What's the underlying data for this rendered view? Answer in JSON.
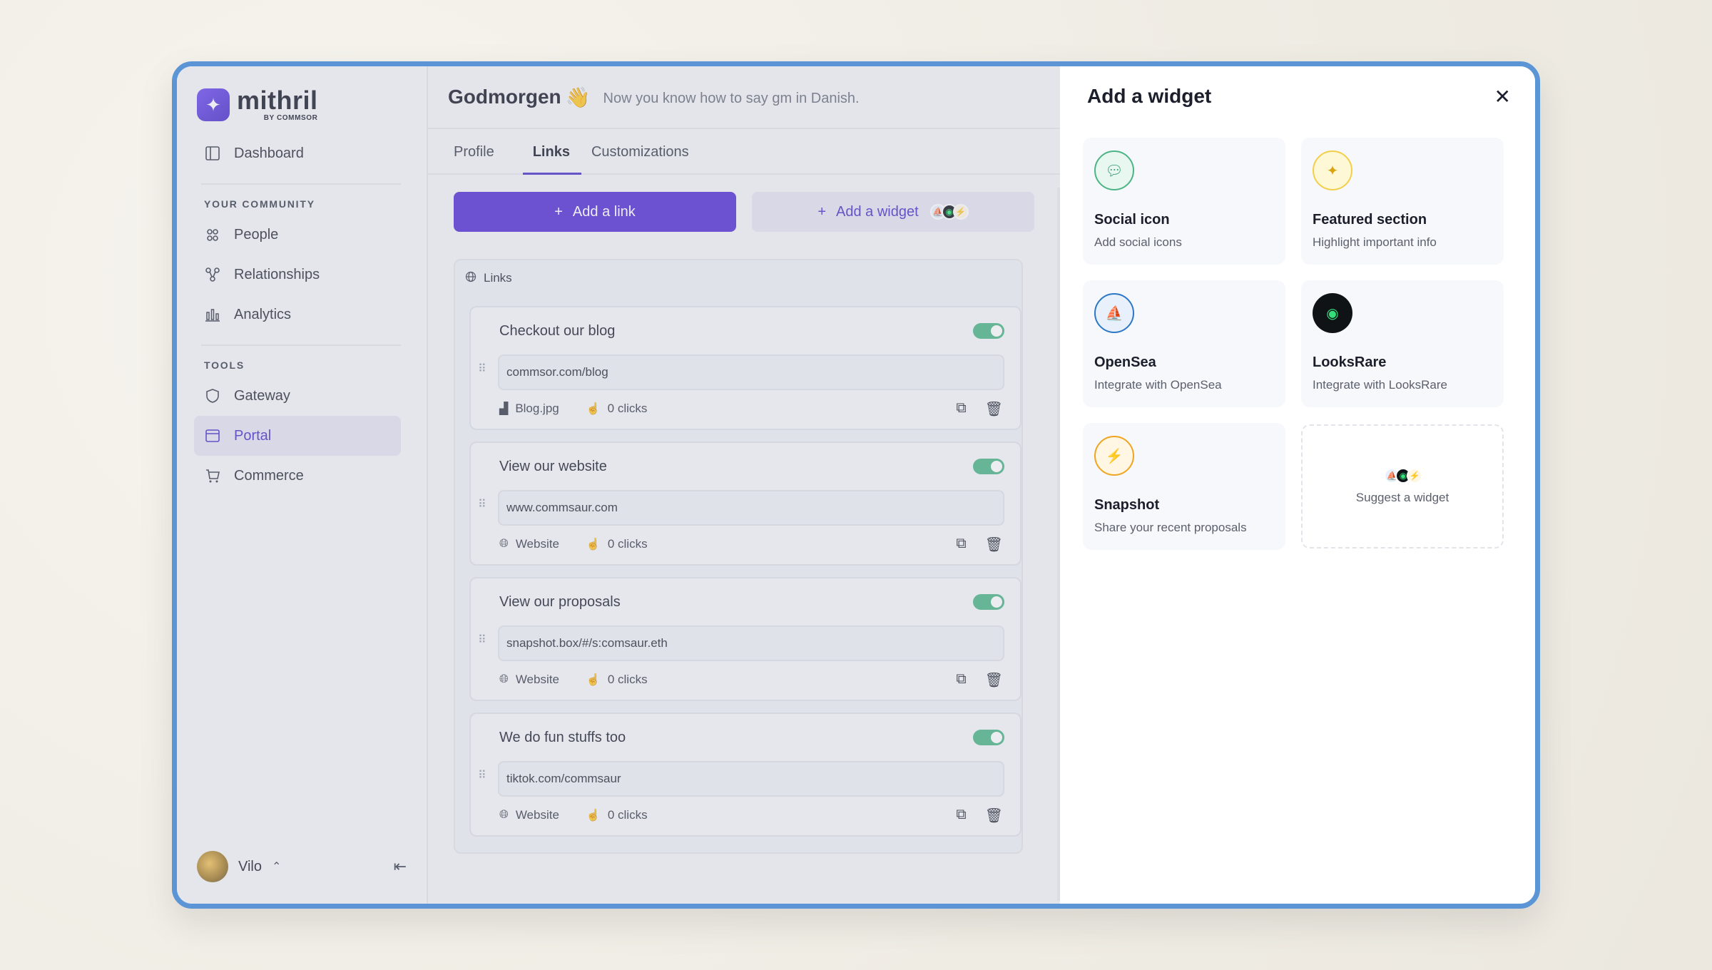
{
  "brand": {
    "name": "mithril",
    "sub": "BY COMMSOR"
  },
  "sidebar": {
    "dashboard": "Dashboard",
    "community_label": "YOUR COMMUNITY",
    "community": [
      "People",
      "Relationships",
      "Analytics"
    ],
    "tools_label": "TOOLS",
    "tools": [
      "Gateway",
      "Portal",
      "Commerce"
    ],
    "active": "Portal",
    "user": "Vilo"
  },
  "header": {
    "greeting": "Godmorgen",
    "emoji": "👋",
    "subtitle": "Now you know how to say gm in Danish."
  },
  "tabs": [
    "Profile",
    "Links",
    "Customizations"
  ],
  "active_tab": "Links",
  "actions": {
    "add_link": "Add a link",
    "add_widget": "Add a widget"
  },
  "links_panel": {
    "title": "Links",
    "items": [
      {
        "title": "Checkout our blog",
        "url": "commsor.com/blog",
        "meta": "Blog.jpg",
        "clicks": "0 clicks",
        "enabled": true
      },
      {
        "title": "View our website",
        "url": "www.commsaur.com",
        "meta": "Website",
        "clicks": "0 clicks",
        "enabled": true
      },
      {
        "title": "View our proposals",
        "url": "snapshot.box/#/s:comsaur.eth",
        "meta": "Website",
        "clicks": "0 clicks",
        "enabled": true
      },
      {
        "title": "We do fun stuffs too",
        "url": "tiktok.com/commsaur",
        "meta": "Website",
        "clicks": "0 clicks",
        "enabled": true
      }
    ]
  },
  "drawer": {
    "title": "Add a widget",
    "widgets": [
      {
        "name": "Social icon",
        "desc": "Add social icons",
        "icon": "chat-icon",
        "color": "#e8f7ef"
      },
      {
        "name": "Featured section",
        "desc": "Highlight important info",
        "icon": "sparkle-icon",
        "color": "#fff8d6"
      },
      {
        "name": "OpenSea",
        "desc": "Integrate with OpenSea",
        "icon": "opensea-icon",
        "color": "#e8f1fb"
      },
      {
        "name": "LooksRare",
        "desc": "Integrate with LooksRare",
        "icon": "looksrare-icon",
        "color": "#0f1316"
      },
      {
        "name": "Snapshot",
        "desc": "Share your recent proposals",
        "icon": "lightning-icon",
        "color": "#fff6e3"
      }
    ],
    "suggest": "Suggest a widget"
  },
  "colors": {
    "accent": "#5431d4",
    "frame": "#5b95d6",
    "toggle": "#4bb586"
  }
}
